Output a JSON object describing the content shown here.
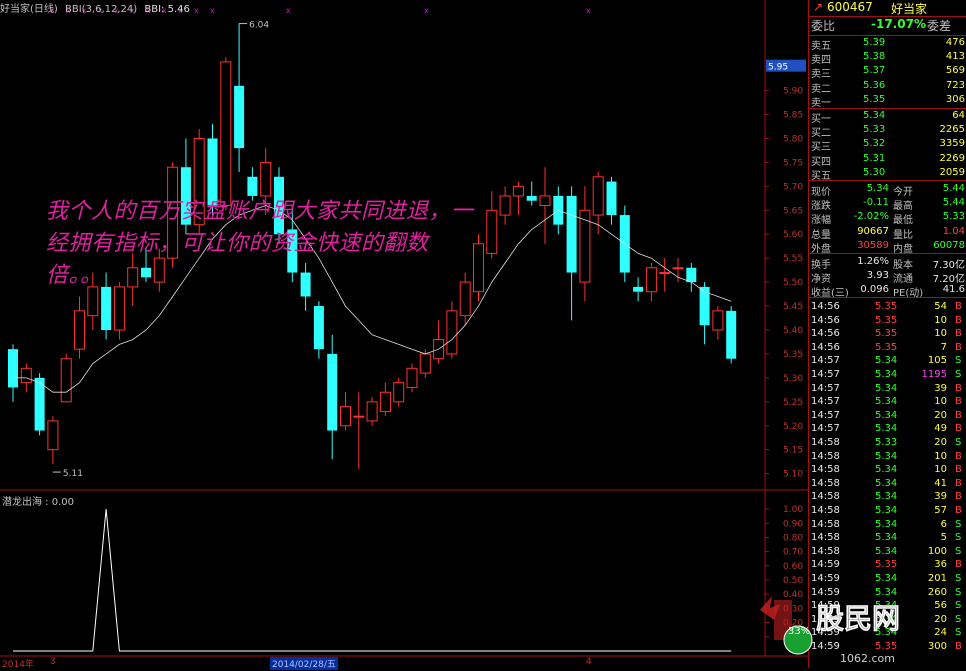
{
  "header": {
    "title": "好当家(日线)",
    "indicator": "BBI(3,6,12,24)",
    "bbi_value": "BBI: 5.46"
  },
  "overlay_text": "我个人的百万实盘账户跟大家共同进退，一经拥有指标，可让你的资金快速的翻数倍。。",
  "price_axis": {
    "labels": [
      "5.95",
      "5.90",
      "5.85",
      "5.80",
      "5.75",
      "5.70",
      "5.65",
      "5.60",
      "5.55",
      "5.50",
      "5.45",
      "5.40",
      "5.35",
      "5.30",
      "5.25",
      "5.20",
      "5.15",
      "5.10"
    ],
    "current_tag": "5.95"
  },
  "sub_axis": {
    "labels": [
      "1.00",
      "0.90",
      "0.80",
      "0.70",
      "0.60",
      "0.50",
      "0.40",
      "0.30",
      "0.20",
      "0.10"
    ]
  },
  "sub_label": "潜龙出海 : 0.00",
  "annotations": {
    "high": "6.04",
    "low": "5.11"
  },
  "date_bar": {
    "left": "2014年",
    "m1": "3",
    "highlight": "2014/02/28/五",
    "m2": "4"
  },
  "chart_data": {
    "type": "candlestick",
    "ylim": [
      5.07,
      6.06
    ],
    "candles": [
      {
        "o": 5.36,
        "h": 5.37,
        "l": 5.25,
        "c": 5.28
      },
      {
        "o": 5.29,
        "h": 5.33,
        "l": 5.27,
        "c": 5.32
      },
      {
        "o": 5.3,
        "h": 5.31,
        "l": 5.18,
        "c": 5.19
      },
      {
        "o": 5.15,
        "h": 5.22,
        "l": 5.12,
        "c": 5.21
      },
      {
        "o": 5.25,
        "h": 5.35,
        "l": 5.25,
        "c": 5.34
      },
      {
        "o": 5.36,
        "h": 5.47,
        "l": 5.34,
        "c": 5.44
      },
      {
        "o": 5.43,
        "h": 5.52,
        "l": 5.4,
        "c": 5.49
      },
      {
        "o": 5.49,
        "h": 5.52,
        "l": 5.38,
        "c": 5.4
      },
      {
        "o": 5.4,
        "h": 5.5,
        "l": 5.38,
        "c": 5.49
      },
      {
        "o": 5.49,
        "h": 5.56,
        "l": 5.45,
        "c": 5.53
      },
      {
        "o": 5.53,
        "h": 5.57,
        "l": 5.5,
        "c": 5.51
      },
      {
        "o": 5.5,
        "h": 5.57,
        "l": 5.48,
        "c": 5.55
      },
      {
        "o": 5.55,
        "h": 5.75,
        "l": 5.53,
        "c": 5.74
      },
      {
        "o": 5.74,
        "h": 5.8,
        "l": 5.6,
        "c": 5.62
      },
      {
        "o": 5.62,
        "h": 5.82,
        "l": 5.6,
        "c": 5.8
      },
      {
        "o": 5.8,
        "h": 5.83,
        "l": 5.64,
        "c": 5.66
      },
      {
        "o": 5.66,
        "h": 5.97,
        "l": 5.65,
        "c": 5.96
      },
      {
        "o": 5.91,
        "h": 6.04,
        "l": 5.73,
        "c": 5.78
      },
      {
        "o": 5.72,
        "h": 5.74,
        "l": 5.67,
        "c": 5.68
      },
      {
        "o": 5.68,
        "h": 5.78,
        "l": 5.64,
        "c": 5.75
      },
      {
        "o": 5.72,
        "h": 5.74,
        "l": 5.58,
        "c": 5.6
      },
      {
        "o": 5.61,
        "h": 5.66,
        "l": 5.5,
        "c": 5.52
      },
      {
        "o": 5.52,
        "h": 5.54,
        "l": 5.44,
        "c": 5.47
      },
      {
        "o": 5.45,
        "h": 5.46,
        "l": 5.34,
        "c": 5.36
      },
      {
        "o": 5.35,
        "h": 5.39,
        "l": 5.13,
        "c": 5.19
      },
      {
        "o": 5.2,
        "h": 5.27,
        "l": 5.19,
        "c": 5.24
      },
      {
        "o": 5.22,
        "h": 5.27,
        "l": 5.11,
        "c": 5.22
      },
      {
        "o": 5.21,
        "h": 5.26,
        "l": 5.2,
        "c": 5.25
      },
      {
        "o": 5.23,
        "h": 5.29,
        "l": 5.22,
        "c": 5.27
      },
      {
        "o": 5.25,
        "h": 5.3,
        "l": 5.24,
        "c": 5.29
      },
      {
        "o": 5.28,
        "h": 5.33,
        "l": 5.27,
        "c": 5.32
      },
      {
        "o": 5.31,
        "h": 5.36,
        "l": 5.3,
        "c": 5.35
      },
      {
        "o": 5.34,
        "h": 5.42,
        "l": 5.33,
        "c": 5.38
      },
      {
        "o": 5.35,
        "h": 5.46,
        "l": 5.34,
        "c": 5.44
      },
      {
        "o": 5.43,
        "h": 5.52,
        "l": 5.41,
        "c": 5.5
      },
      {
        "o": 5.48,
        "h": 5.6,
        "l": 5.46,
        "c": 5.58
      },
      {
        "o": 5.56,
        "h": 5.69,
        "l": 5.55,
        "c": 5.65
      },
      {
        "o": 5.64,
        "h": 5.7,
        "l": 5.62,
        "c": 5.68
      },
      {
        "o": 5.68,
        "h": 5.71,
        "l": 5.64,
        "c": 5.7
      },
      {
        "o": 5.68,
        "h": 5.71,
        "l": 5.66,
        "c": 5.67
      },
      {
        "o": 5.66,
        "h": 5.74,
        "l": 5.58,
        "c": 5.68
      },
      {
        "o": 5.68,
        "h": 5.7,
        "l": 5.6,
        "c": 5.62
      },
      {
        "o": 5.68,
        "h": 5.7,
        "l": 5.42,
        "c": 5.52
      },
      {
        "o": 5.5,
        "h": 5.7,
        "l": 5.46,
        "c": 5.65
      },
      {
        "o": 5.64,
        "h": 5.73,
        "l": 5.6,
        "c": 5.72
      },
      {
        "o": 5.71,
        "h": 5.72,
        "l": 5.62,
        "c": 5.64
      },
      {
        "o": 5.64,
        "h": 5.66,
        "l": 5.5,
        "c": 5.52
      },
      {
        "o": 5.49,
        "h": 5.51,
        "l": 5.46,
        "c": 5.48
      },
      {
        "o": 5.48,
        "h": 5.54,
        "l": 5.46,
        "c": 5.53
      },
      {
        "o": 5.52,
        "h": 5.55,
        "l": 5.48,
        "c": 5.52
      },
      {
        "o": 5.53,
        "h": 5.55,
        "l": 5.5,
        "c": 5.53
      },
      {
        "o": 5.53,
        "h": 5.54,
        "l": 5.48,
        "c": 5.5
      },
      {
        "o": 5.49,
        "h": 5.5,
        "l": 5.37,
        "c": 5.41
      },
      {
        "o": 5.4,
        "h": 5.45,
        "l": 5.38,
        "c": 5.44
      },
      {
        "o": 5.44,
        "h": 5.45,
        "l": 5.33,
        "c": 5.34
      }
    ],
    "bbi_line": [
      5.3,
      5.3,
      5.29,
      5.27,
      5.27,
      5.29,
      5.33,
      5.35,
      5.37,
      5.38,
      5.4,
      5.43,
      5.47,
      5.51,
      5.55,
      5.59,
      5.62,
      5.64,
      5.65,
      5.66,
      5.65,
      5.63,
      5.59,
      5.55,
      5.5,
      5.45,
      5.42,
      5.39,
      5.38,
      5.37,
      5.36,
      5.35,
      5.36,
      5.38,
      5.41,
      5.45,
      5.5,
      5.54,
      5.58,
      5.61,
      5.63,
      5.65,
      5.64,
      5.63,
      5.62,
      5.6,
      5.58,
      5.56,
      5.55,
      5.53,
      5.51,
      5.5,
      5.48,
      5.47,
      5.46
    ],
    "sub_indicator": {
      "name": "潜龙出海",
      "values": [
        0,
        0,
        0,
        0,
        0,
        0,
        0,
        1,
        0,
        0,
        0,
        0,
        0,
        0,
        0,
        0,
        0,
        0,
        0,
        0,
        0,
        0,
        0,
        0,
        0,
        0,
        0,
        0,
        0,
        0,
        0,
        0,
        0,
        0,
        0,
        0,
        0,
        0,
        0,
        0,
        0,
        0,
        0,
        0,
        0,
        0,
        0,
        0,
        0,
        0,
        0,
        0,
        0,
        0,
        0
      ],
      "ylim": [
        0,
        1.05
      ]
    }
  },
  "panel": {
    "code": "600467",
    "name": "好当家",
    "ratio_label": "委比",
    "ratio_value": "-17.07%",
    "diff_label": "委差",
    "asks": [
      {
        "label": "卖五",
        "price": "5.39",
        "vol": "476"
      },
      {
        "label": "卖四",
        "price": "5.38",
        "vol": "413"
      },
      {
        "label": "卖三",
        "price": "5.37",
        "vol": "569"
      },
      {
        "label": "卖二",
        "price": "5.36",
        "vol": "723"
      },
      {
        "label": "卖一",
        "price": "5.35",
        "vol": "306"
      }
    ],
    "bids": [
      {
        "label": "买一",
        "price": "5.34",
        "vol": "64"
      },
      {
        "label": "买二",
        "price": "5.33",
        "vol": "2265"
      },
      {
        "label": "买三",
        "price": "5.32",
        "vol": "3359"
      },
      {
        "label": "买四",
        "price": "5.31",
        "vol": "2269"
      },
      {
        "label": "买五",
        "price": "5.30",
        "vol": "2059"
      }
    ],
    "stats": [
      {
        "l1": "现价",
        "v1": "5.34",
        "l2": "今开",
        "v2": "5.44",
        "c1": "c-green",
        "c2": "c-green"
      },
      {
        "l1": "涨跌",
        "v1": "-0.11",
        "l2": "最高",
        "v2": "5.44",
        "c1": "c-green",
        "c2": "c-green"
      },
      {
        "l1": "涨幅",
        "v1": "-2.02%",
        "l2": "最低",
        "v2": "5.33",
        "c1": "c-green",
        "c2": "c-green"
      },
      {
        "l1": "总量",
        "v1": "90667",
        "l2": "量比",
        "v2": "1.04",
        "c1": "c-yellow",
        "c2": "c-red"
      },
      {
        "l1": "外盘",
        "v1": "30589",
        "l2": "内盘",
        "v2": "60078",
        "c1": "c-red",
        "c2": "c-green"
      }
    ],
    "stats2": [
      {
        "l1": "换手",
        "v1": "1.26%",
        "l2": "股本",
        "v2": "7.30亿",
        "c1": "c-white",
        "c2": "c-white"
      },
      {
        "l1": "净资",
        "v1": "3.93",
        "l2": "流通",
        "v2": "7.20亿",
        "c1": "c-white",
        "c2": "c-white"
      },
      {
        "l1": "收益(三)",
        "v1": "0.096",
        "l2": "PE(动)",
        "v2": "41.6",
        "c1": "c-white",
        "c2": "c-white"
      }
    ],
    "ticks": [
      {
        "t": "14:56",
        "p": "5.35",
        "v": "54",
        "s": "B"
      },
      {
        "t": "14:56",
        "p": "5.35",
        "v": "10",
        "s": "B"
      },
      {
        "t": "14:56",
        "p": "5.35",
        "v": "10",
        "s": "B"
      },
      {
        "t": "14:56",
        "p": "5.35",
        "v": "7",
        "s": "B"
      },
      {
        "t": "14:57",
        "p": "5.34",
        "v": "105",
        "s": "S"
      },
      {
        "t": "14:57",
        "p": "5.34",
        "v": "1195",
        "s": "S"
      },
      {
        "t": "14:57",
        "p": "5.34",
        "v": "39",
        "s": "B"
      },
      {
        "t": "14:57",
        "p": "5.34",
        "v": "10",
        "s": "B"
      },
      {
        "t": "14:57",
        "p": "5.34",
        "v": "20",
        "s": "B"
      },
      {
        "t": "14:57",
        "p": "5.34",
        "v": "49",
        "s": "B"
      },
      {
        "t": "14:58",
        "p": "5.33",
        "v": "20",
        "s": "S"
      },
      {
        "t": "14:58",
        "p": "5.34",
        "v": "10",
        "s": "B"
      },
      {
        "t": "14:58",
        "p": "5.34",
        "v": "10",
        "s": "B"
      },
      {
        "t": "14:58",
        "p": "5.34",
        "v": "41",
        "s": "B"
      },
      {
        "t": "14:58",
        "p": "5.34",
        "v": "39",
        "s": "B"
      },
      {
        "t": "14:58",
        "p": "5.34",
        "v": "57",
        "s": "B"
      },
      {
        "t": "14:58",
        "p": "5.34",
        "v": "6",
        "s": "S"
      },
      {
        "t": "14:58",
        "p": "5.34",
        "v": "5",
        "s": "S"
      },
      {
        "t": "14:58",
        "p": "5.34",
        "v": "100",
        "s": "S"
      },
      {
        "t": "14:59",
        "p": "5.35",
        "v": "36",
        "s": "B"
      },
      {
        "t": "14:59",
        "p": "5.34",
        "v": "201",
        "s": "S"
      },
      {
        "t": "14:59",
        "p": "5.34",
        "v": "260",
        "s": "S"
      },
      {
        "t": "14:59",
        "p": "5.34",
        "v": "56",
        "s": "S"
      },
      {
        "t": "14:59",
        "p": "5.34",
        "v": "20",
        "s": "S"
      },
      {
        "t": "14:59",
        "p": "5.34",
        "v": "24",
        "s": "S"
      },
      {
        "t": "14:59",
        "p": "5.35",
        "v": "300",
        "s": "B"
      }
    ]
  },
  "watermark": {
    "text": "股民网",
    "badge": "33%",
    "url": "1062.com"
  },
  "colors": {
    "up": "#ff3030",
    "down": "#30ffff",
    "bbi": "#e0e0e0",
    "axis": "#a01010",
    "sub": "#ffffff"
  }
}
